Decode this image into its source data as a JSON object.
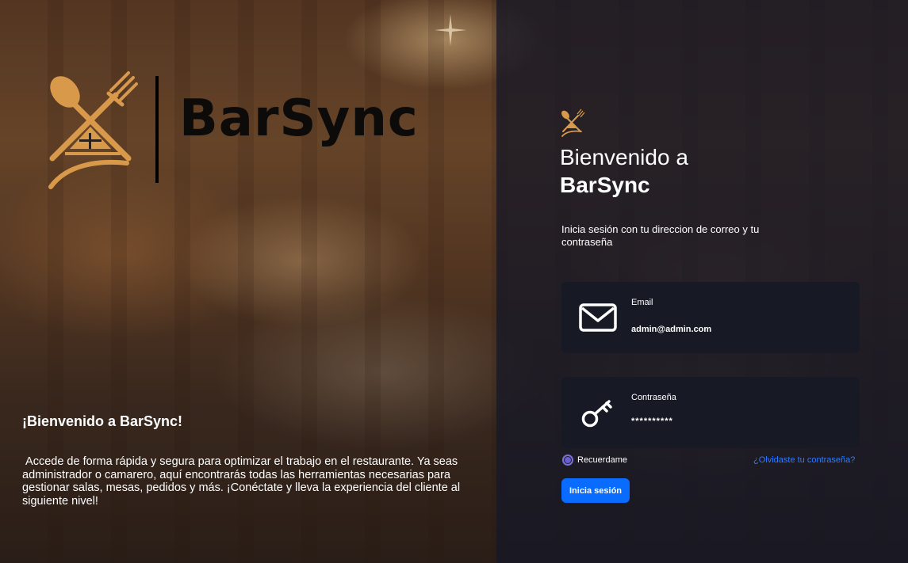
{
  "brand": {
    "name": "BarSync",
    "accent_color": "#d89a4a"
  },
  "left_panel": {
    "title": "¡Bienvenido a BarSync!",
    "description": " Accede de forma rápida y segura para optimizar el trabajo en el restaurante. Ya seas administrador o camarero, aquí encontrarás todas las herramientas necesarias para gestionar salas, mesas, pedidos y más. ¡Conéctate y lleva la experiencia del cliente al siguiente nivel!"
  },
  "login": {
    "welcome_line1": "Bienvenido a",
    "welcome_line2": "BarSync",
    "subtitle": "Inicia sesión con tu direccion de correo y tu contraseña",
    "email": {
      "label": "Email",
      "value": "admin@admin.com",
      "icon": "envelope-icon"
    },
    "password": {
      "label": "Contraseña",
      "value": "**********",
      "icon": "key-icon"
    },
    "remember_label": "Recuerdame",
    "remember_checked": true,
    "forgot_label": "¿Olvidaste tu contraseña?",
    "submit_label": "Inicia sesión",
    "submit_color": "#0a6cff",
    "link_color": "#2f7bff"
  }
}
